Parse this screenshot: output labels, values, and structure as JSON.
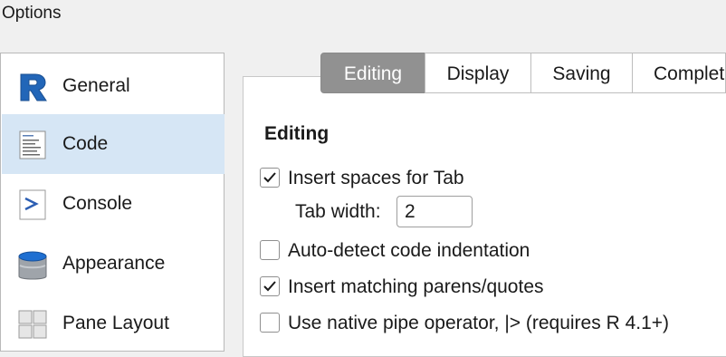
{
  "window": {
    "title": "Options"
  },
  "sidebar": {
    "items": [
      {
        "label": "General",
        "icon": "r-logo-icon",
        "selected": false
      },
      {
        "label": "Code",
        "icon": "code-document-icon",
        "selected": true
      },
      {
        "label": "Console",
        "icon": "console-prompt-icon",
        "selected": false
      },
      {
        "label": "Appearance",
        "icon": "paint-bucket-icon",
        "selected": false
      },
      {
        "label": "Pane Layout",
        "icon": "pane-layout-icon",
        "selected": false
      }
    ]
  },
  "tabs": [
    {
      "label": "Editing",
      "active": true
    },
    {
      "label": "Display",
      "active": false
    },
    {
      "label": "Saving",
      "active": false
    },
    {
      "label": "Complet",
      "active": false
    }
  ],
  "editing": {
    "section_title": "Editing",
    "options": [
      {
        "label": "Insert spaces for Tab",
        "checked": true
      },
      {
        "label": "Auto-detect code indentation",
        "checked": false
      },
      {
        "label": "Insert matching parens/quotes",
        "checked": true
      },
      {
        "label": "Use native pipe operator, |> (requires R 4.1+)",
        "checked": false
      }
    ],
    "tab_width": {
      "label": "Tab width:",
      "value": "2"
    }
  },
  "colors": {
    "selected_bg": "#d6e6f5",
    "active_tab_bg": "#919191",
    "r_blue": "#2266b8"
  }
}
